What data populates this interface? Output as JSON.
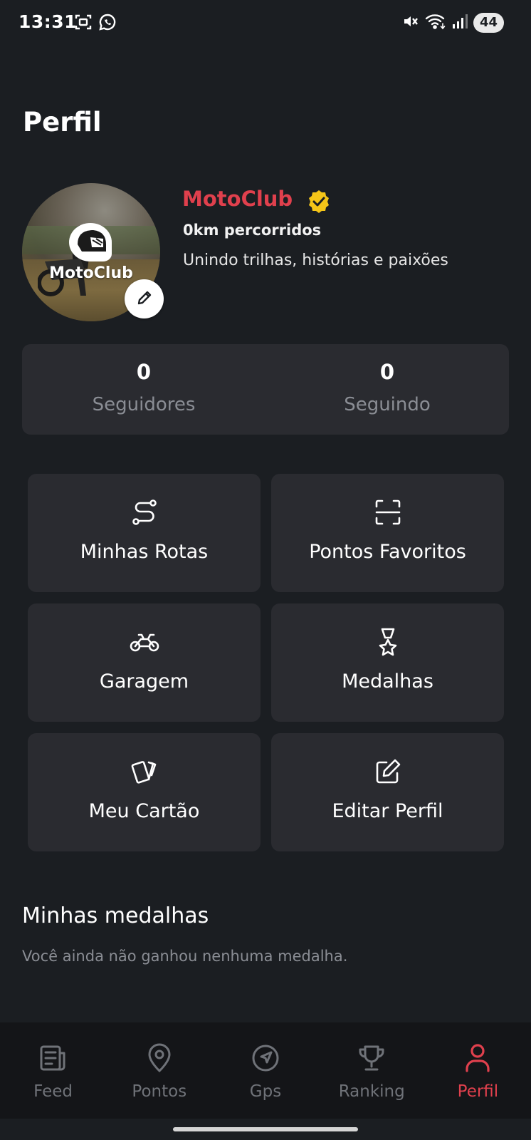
{
  "status_bar": {
    "time": "13:31",
    "battery": "44",
    "icons": [
      "screenshot-icon",
      "whatsapp-icon",
      "mute-icon",
      "wifi-icon",
      "signal-icon"
    ]
  },
  "header": {
    "title": "Perfil"
  },
  "profile": {
    "name": "MotoClub",
    "avatar_brand_text": "MotoClub",
    "distance": "0km percorridos",
    "bio": "Unindo trilhas, histórias e paixões",
    "verified": true,
    "name_color": "#e0404d",
    "verified_color": "#f5c518"
  },
  "stats": [
    {
      "value": "0",
      "label": "Seguidores"
    },
    {
      "value": "0",
      "label": "Seguindo"
    }
  ],
  "menu": [
    {
      "label": "Minhas Rotas",
      "icon": "route-icon"
    },
    {
      "label": "Pontos Favoritos",
      "icon": "scan-icon"
    },
    {
      "label": "Garagem",
      "icon": "motorcycle-icon"
    },
    {
      "label": "Medalhas",
      "icon": "medal-icon"
    },
    {
      "label": "Meu Cartão",
      "icon": "cards-icon"
    },
    {
      "label": "Editar Perfil",
      "icon": "edit-icon"
    }
  ],
  "medals_section": {
    "title": "Minhas medalhas",
    "empty_text": "Você ainda não ganhou nenhuma medalha."
  },
  "bottom_nav": [
    {
      "label": "Feed",
      "icon": "feed-icon",
      "active": false
    },
    {
      "label": "Pontos",
      "icon": "location-pin-icon",
      "active": false
    },
    {
      "label": "Gps",
      "icon": "navigation-icon",
      "active": false
    },
    {
      "label": "Ranking",
      "icon": "trophy-icon",
      "active": false
    },
    {
      "label": "Perfil",
      "icon": "user-icon",
      "active": true
    }
  ],
  "colors": {
    "background": "#1b1e22",
    "card": "#2a2b30",
    "accent": "#e0404d",
    "muted": "#8a8d94"
  }
}
